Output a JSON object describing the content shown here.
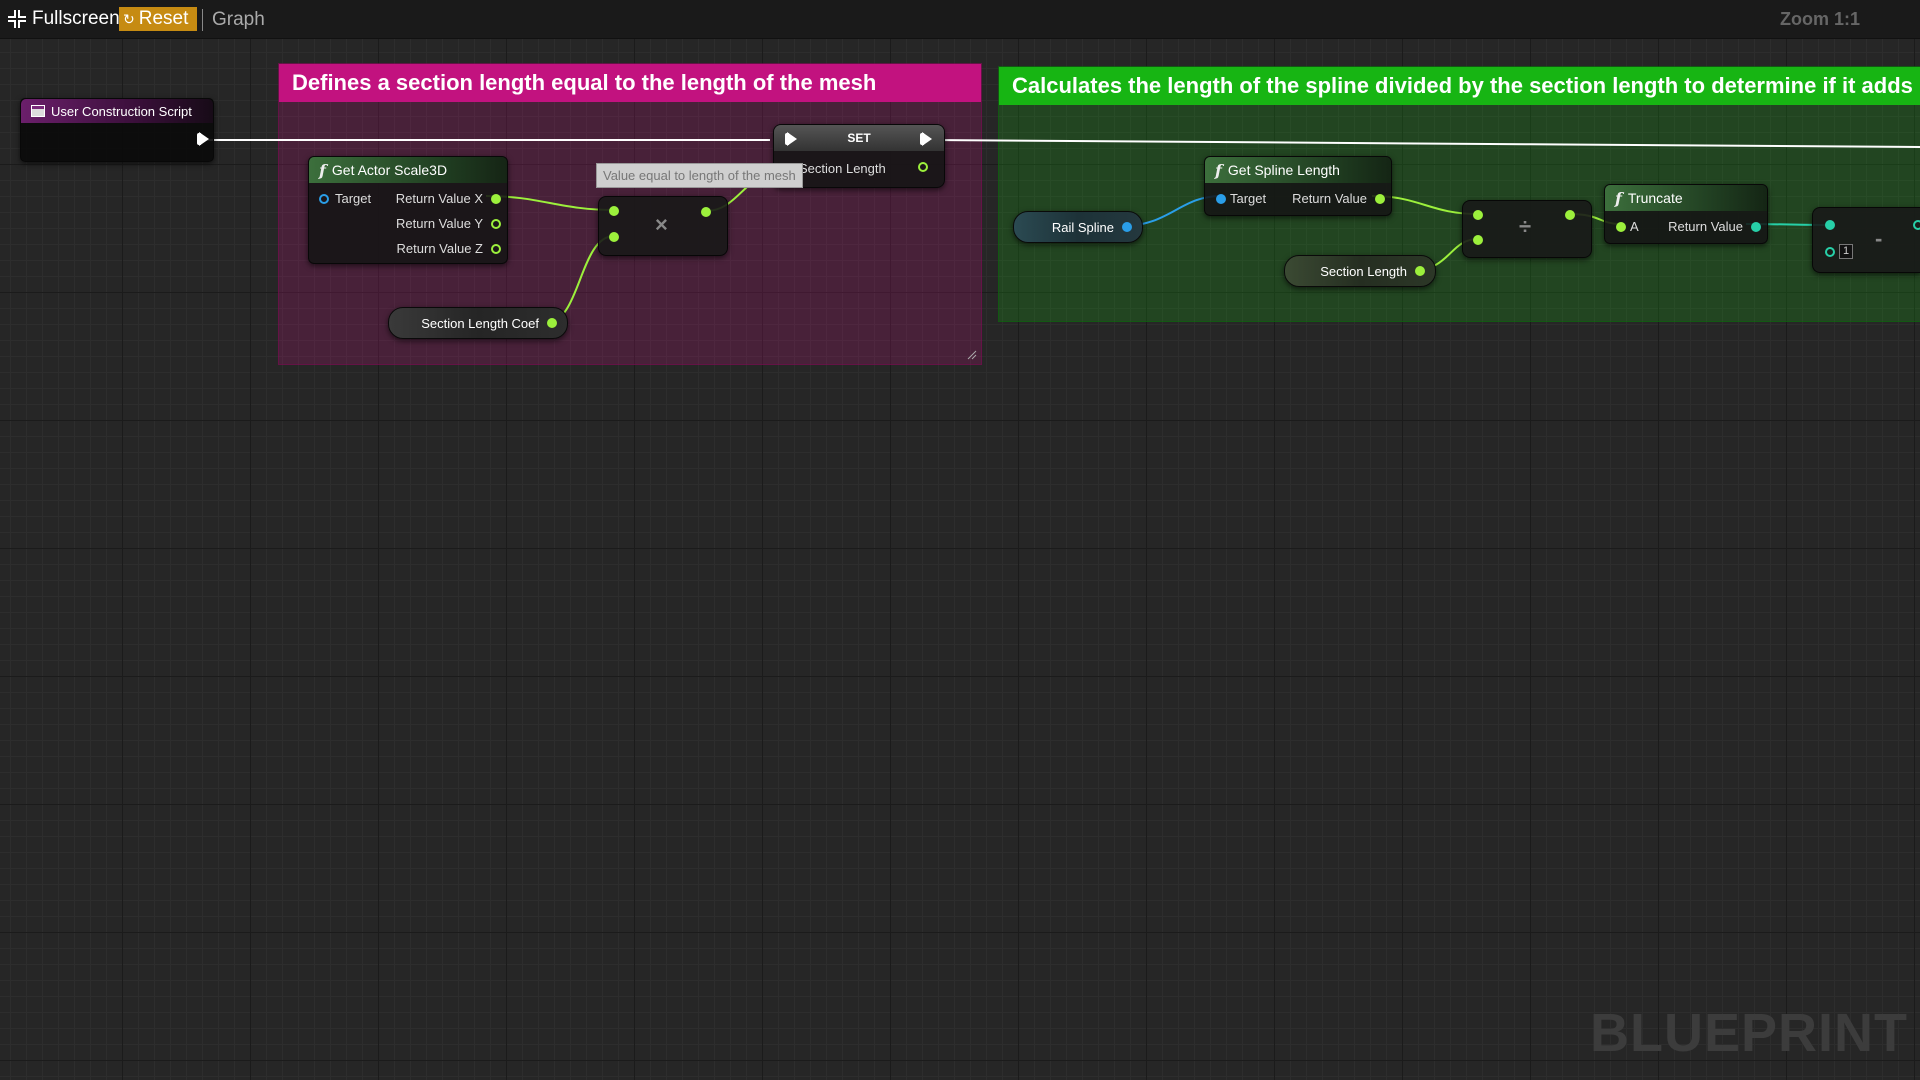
{
  "toolbar": {
    "fullscreen_label": "Fullscreen",
    "reset_label": "Reset",
    "breadcrumb": "Graph",
    "zoom": "Zoom 1:1"
  },
  "comments": {
    "section": {
      "title": "Defines a section length equal to the length of the mesh",
      "color": "#c2127f"
    },
    "spline": {
      "title": "Calculates the length of the spline divided by the section length to determine if it adds",
      "color": "#17b513"
    }
  },
  "nodes": {
    "event": {
      "title": "User Construction Script"
    },
    "get_scale": {
      "title": "Get Actor Scale3D",
      "input_target": "Target",
      "out_x": "Return Value X",
      "out_y": "Return Value Y",
      "out_z": "Return Value Z"
    },
    "set": {
      "title": "SET",
      "pin": "Section Length"
    },
    "tooltip": "Value equal to length of the mesh",
    "section_coef": "Section Length Coef",
    "multiply_symbol": "×",
    "divide_symbol": "÷",
    "subtract_symbol": "-",
    "rail_spline": "Rail Spline",
    "get_spline_length": {
      "title": "Get Spline Length",
      "input_target": "Target",
      "output": "Return Value"
    },
    "section_length_var": "Section Length",
    "truncate": {
      "title": "Truncate",
      "input": "A",
      "output": "Return Value"
    },
    "subtract_literal": "1"
  },
  "watermark": "BLUEPRINT",
  "colors": {
    "float_pin": "#9cf03c",
    "object_pin": "#2a9ee8",
    "int_pin": "#27d0a8",
    "exec_pin": "#ffffff",
    "reset_button": "#c68b12"
  }
}
